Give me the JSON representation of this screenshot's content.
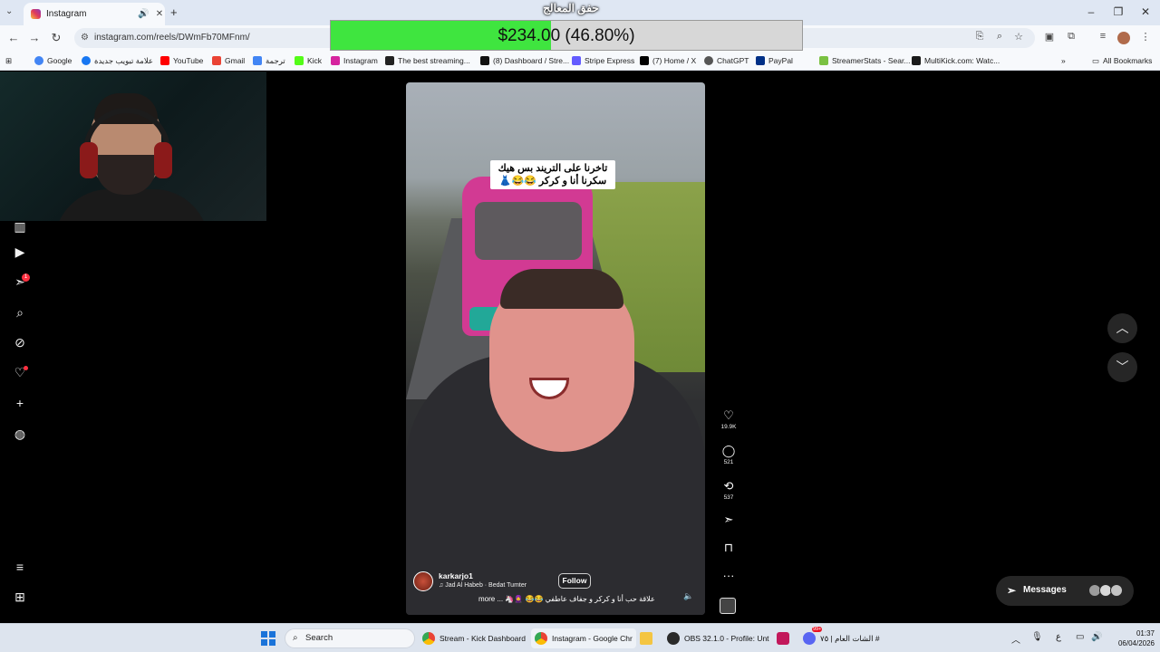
{
  "browser": {
    "tab_title": "Instagram",
    "url": "instagram.com/reels/DWmFb70MFnm/",
    "bookmarks": [
      "Google",
      "علامة تبويب جديدة",
      "YouTube",
      "Gmail",
      "ترجمة",
      "Kick",
      "Instagram",
      "The best streaming...",
      "(8) Dashboard / Stre...",
      "Stripe Express",
      "(7) Home / X",
      "ChatGPT",
      "PayPal",
      "StreamerStats - Sear...",
      "MultiKick.com: Watc..."
    ],
    "all_bookmarks": "All Bookmarks"
  },
  "donation": {
    "title": "حفق المعالج",
    "text": "$234.00 (46.80%)",
    "percent": 46.8,
    "fill_color": "#3fe53f"
  },
  "reel": {
    "overlay_text": "تاخرنا على التريند بس هيك\nسكرنا أنا و كركر 😂😂👗",
    "username": "karkarjo1",
    "audio": "♫ Jad Al Habeb · Bedat Tumter",
    "follow_label": "Follow",
    "description": "علاقة حب أنا و كركر و جفاف عاطفي 😂😂 🧕🦄 ... more",
    "likes": "19.9K",
    "comments": "521",
    "reposts": "537"
  },
  "sidebar": {
    "notification_count": "1"
  },
  "messages": {
    "label": "Messages"
  },
  "taskbar": {
    "search_placeholder": "Search",
    "apps": [
      "Stream - Kick Dashboard",
      "Instagram - Google Chr",
      "OBS 32.1.0 - Profile: Unt",
      "الشات العام | ٧٥ #"
    ],
    "discord_badge": "99+",
    "lang": "ع",
    "time": "01:37",
    "date": "06/04/2026"
  }
}
